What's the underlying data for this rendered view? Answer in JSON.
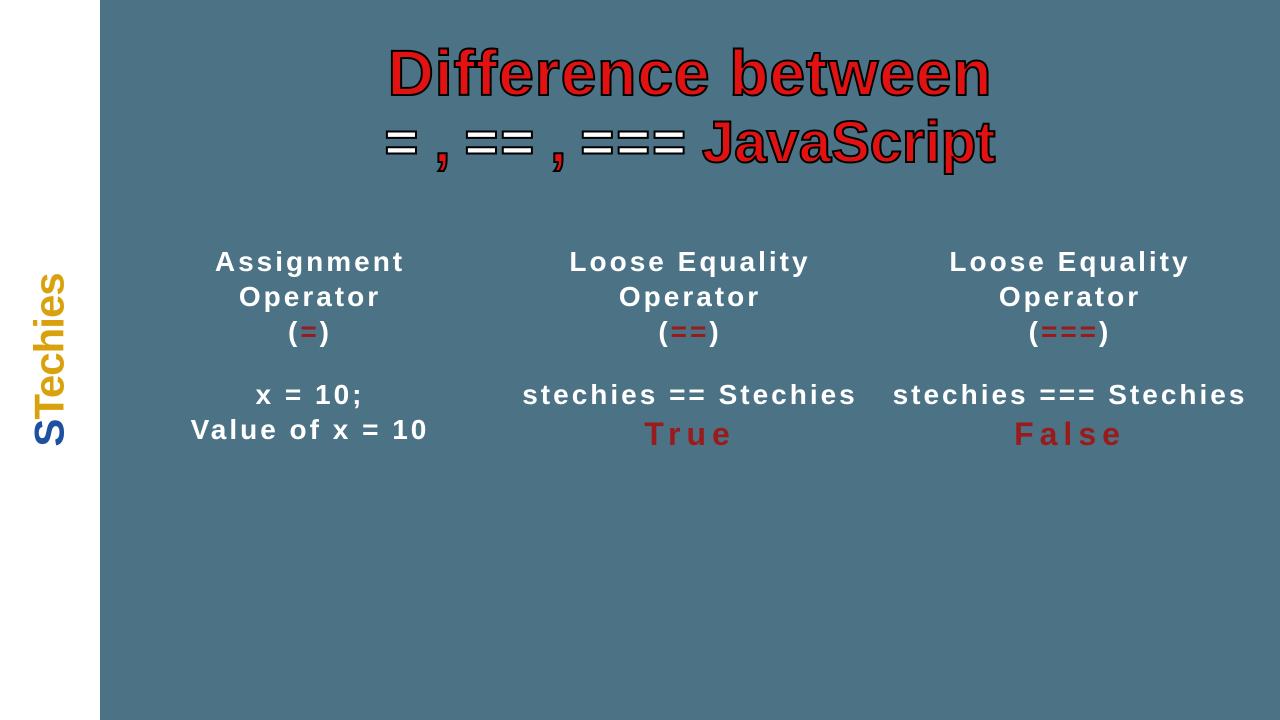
{
  "logo": {
    "first": "S",
    "rest": "Techies"
  },
  "title": {
    "line1": "Difference between",
    "op1": "=",
    "op2": "==",
    "op3": "===",
    "comma": ",",
    "js": "JavaScript"
  },
  "columns": [
    {
      "heading_l1": "Assignment",
      "heading_l2": "Operator",
      "symbol": "=",
      "example_l1": "x = 10;",
      "example_l2": "Value of x = 10",
      "result": ""
    },
    {
      "heading_l1": "Loose Equality",
      "heading_l2": "Operator",
      "symbol": "==",
      "example_l1": "stechies == Stechies",
      "example_l2": "",
      "result": "True"
    },
    {
      "heading_l1": "Loose Equality",
      "heading_l2": "Operator",
      "symbol": "===",
      "example_l1": "stechies === Stechies",
      "example_l2": "",
      "result": "False"
    }
  ]
}
